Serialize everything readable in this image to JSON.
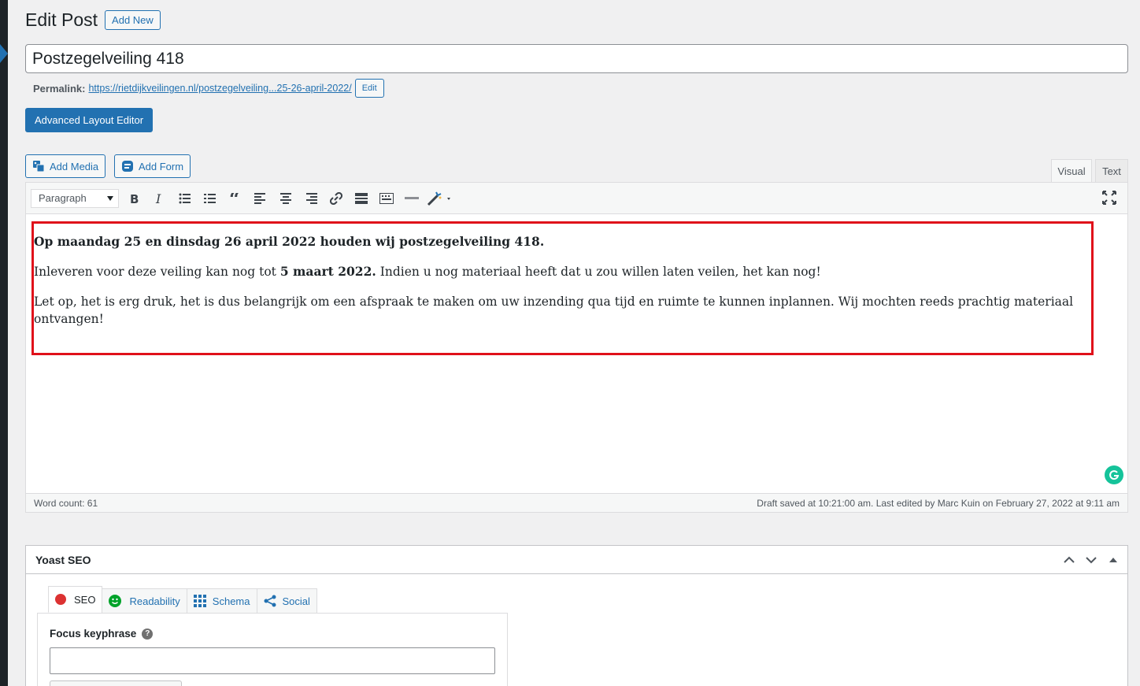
{
  "page": {
    "title": "Edit Post",
    "add_new": "Add New",
    "post_title": "Postzegelveiling 418",
    "permalink_label": "Permalink:",
    "permalink_url": "https://rietdijkveilingen.nl/postzegelveiling...25-26-april-2022/",
    "permalink_edit": "Edit",
    "advanced_layout_editor": "Advanced Layout Editor"
  },
  "media": {
    "add_media": "Add Media",
    "add_form": "Add Form"
  },
  "editor_tabs": {
    "visual": "Visual",
    "text": "Text"
  },
  "toolbar": {
    "format_select": "Paragraph",
    "buttons": [
      "bold-icon",
      "italic-icon",
      "bullet-list-icon",
      "numbered-list-icon",
      "blockquote-icon",
      "align-left-icon",
      "align-center-icon",
      "align-right-icon",
      "link-icon",
      "read-more-icon",
      "toolbar-toggle-icon",
      "horizontal-line-icon",
      "magic-wand-icon"
    ]
  },
  "content": {
    "p1_part1": "Op maandag 25 en dinsdag 26 april 2022 houden wij postzegelveiling 418.",
    "p2_part1": "Inleveren voor deze veiling kan nog tot ",
    "p2_bold": "5 maart 2022.",
    "p2_part2": " Indien u nog materiaal heeft dat u zou willen laten veilen, het kan nog!",
    "p3": "Let op, het is erg druk, het is dus belangrijk om een afspraak te maken om uw inzending qua tijd en ruimte te kunnen inplannen. Wij mochten reeds prachtig materiaal ontvangen!"
  },
  "status": {
    "word_count": "Word count: 61",
    "draft_saved": "Draft saved at 10:21:00 am. Last edited by Marc Kuin on February 27, 2022 at 9:11 am"
  },
  "yoast": {
    "title": "Yoast SEO",
    "tabs": [
      {
        "label": "SEO",
        "color": "#dc3232"
      },
      {
        "label": "Readability",
        "color": "#00a32a"
      },
      {
        "label": "Schema",
        "color": "#2271b1"
      },
      {
        "label": "Social",
        "color": "#2271b1"
      }
    ],
    "focus_keyphrase_label": "Focus keyphrase",
    "help": "?"
  },
  "colors": {
    "accent": "#2271b1",
    "highlight_border": "#e0101a",
    "grammarly": "#15c39a"
  }
}
